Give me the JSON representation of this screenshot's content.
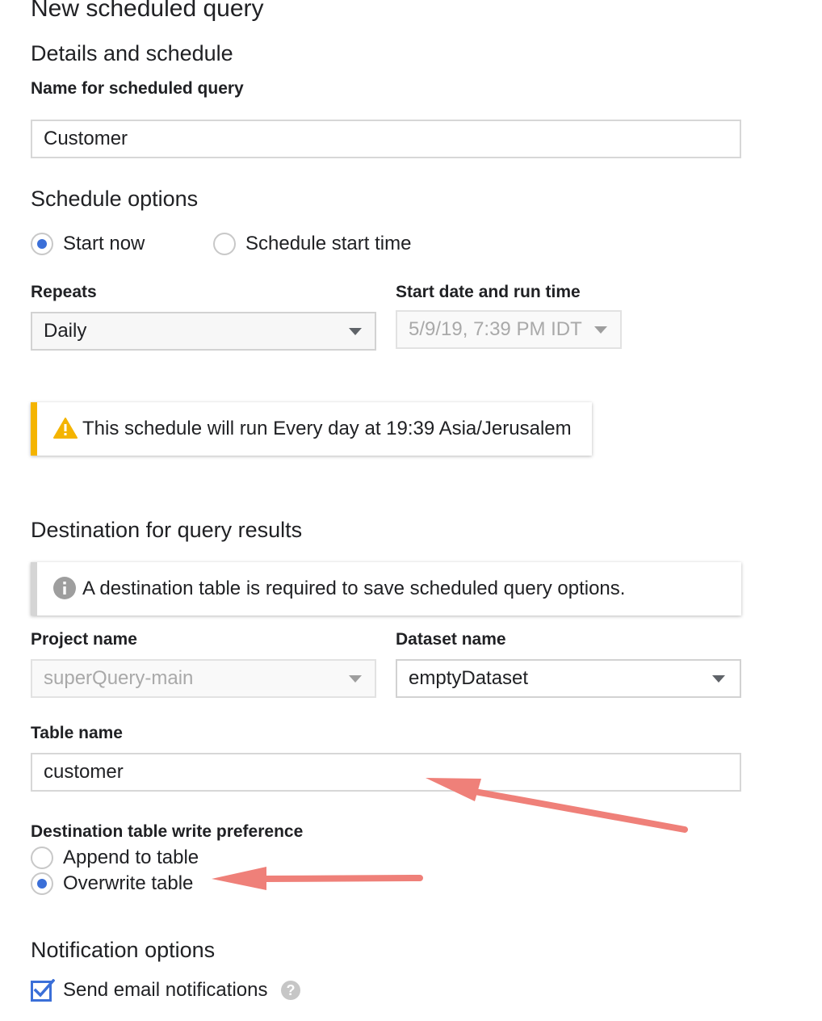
{
  "page_title": "New scheduled query",
  "details": {
    "heading": "Details and schedule",
    "name_label": "Name for scheduled query",
    "name_value": "Customer"
  },
  "schedule": {
    "heading": "Schedule options",
    "radio_start_now": "Start now",
    "radio_schedule_start": "Schedule start time",
    "selected": "Start now",
    "repeats_label": "Repeats",
    "repeats_value": "Daily",
    "start_label": "Start date and run time",
    "start_value": "5/9/19, 7:39 PM IDT",
    "warning_text": "This schedule will run Every day at 19:39 Asia/Jerusalem",
    "warning_color": "#f4b400"
  },
  "destination": {
    "heading": "Destination for query results",
    "info_text": "A destination table is required to save scheduled query options.",
    "project_label": "Project name",
    "project_value": "superQuery-main",
    "dataset_label": "Dataset name",
    "dataset_value": "emptyDataset",
    "table_label": "Table name",
    "table_value": "customer",
    "write_pref_label": "Destination table write preference",
    "write_append": "Append to table",
    "write_overwrite": "Overwrite table",
    "write_selected": "Overwrite table"
  },
  "notifications": {
    "heading": "Notification options",
    "email_label": "Send email notifications",
    "email_checked": true
  },
  "colors": {
    "accent": "#3b6fd8",
    "annotation_arrow": "#ef8079"
  }
}
